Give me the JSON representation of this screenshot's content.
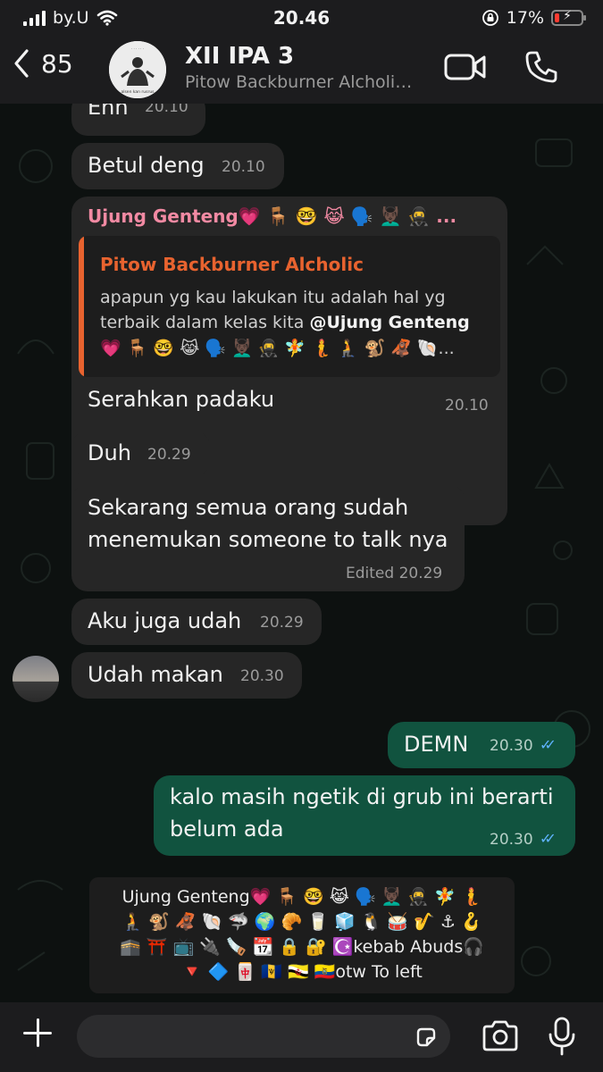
{
  "status_bar": {
    "carrier": "by.U",
    "time": "20.46",
    "battery_percent": "17%",
    "battery_level": 0.17,
    "icons": [
      "signal-icon",
      "wifi-icon",
      "orientation-lock-icon",
      "battery-charging-icon"
    ]
  },
  "header": {
    "back_count": "85",
    "title": "XII IPA 3",
    "subtitle": "Pitow Backburner Alcholi…",
    "avatar_caption": "alsen kan rusrus",
    "icons": [
      "back-chevron-icon",
      "video-call-icon",
      "phone-call-icon"
    ]
  },
  "messages": [
    {
      "text": "Ehh",
      "time": "20.10"
    },
    {
      "text": "Betul deng",
      "time": "20.10"
    },
    {
      "sender": "Ujung Genteng💗 🪑 🤓 😹 🗣️ 💆🏿‍♂️ 🥷 ...",
      "quote": {
        "author": "Pitow Backburner Alcholic",
        "line1": "apapun yg kau lakukan itu adalah hal yg",
        "line2_prefix": "terbaik dalam kelas kita ",
        "mention": "@Ujung Genteng",
        "line3": "💗 🪑 🤓 😹 🗣️ 💆🏿‍♂️ 🥷 🧚 🧜 🧎 🐒 🦧 🐚..."
      },
      "text": "Serahkan padaku",
      "time": "20.10"
    },
    {
      "text": "Duh",
      "time": "20.29"
    },
    {
      "line1": "Sekarang semua orang sudah",
      "line2": "menemukan someone to talk nya",
      "time": "Edited 20.29"
    },
    {
      "text": "Aku juga udah",
      "time": "20.29"
    },
    {
      "text": "Udah makan",
      "time": "20.30"
    },
    {
      "text": "DEMN",
      "time": "20.30",
      "outgoing": true,
      "read": true
    },
    {
      "line1": "kalo masih ngetik di grub ini berarti",
      "line2": "belum ada",
      "time": "20.30",
      "outgoing": true,
      "read": true
    }
  ],
  "notice": {
    "line1": "Ujung Genteng💗 🪑 🤓 😹 🗣️ 💆🏿‍♂️ 🥷 🧚 🧜",
    "line2": "🧎 🐒 🦧 🐚 🦈 🌍 🥐 🥛 🧊 🐧 🥁 🎷 ⚓ 🪝",
    "line3": "🕋 ⛩️ 📺 🔌 🪚 📆 🔒 🔐 ☪️kebab Abuds🎧",
    "line4": "🔻 🔷 🀄 🇧🇧 🇧🇳 🇪🇨otw To left"
  },
  "input_bar": {
    "placeholder": "",
    "icons": [
      "plus-icon",
      "sticker-icon",
      "camera-icon",
      "microphone-icon"
    ]
  },
  "colors": {
    "incoming_bubble": "#262626",
    "outgoing_bubble": "#11533f",
    "quote_accent": "#e8632f",
    "sender_name": "#f28aa3",
    "read_ticks": "#5fb3ff",
    "battery_low": "#ff3b30"
  }
}
